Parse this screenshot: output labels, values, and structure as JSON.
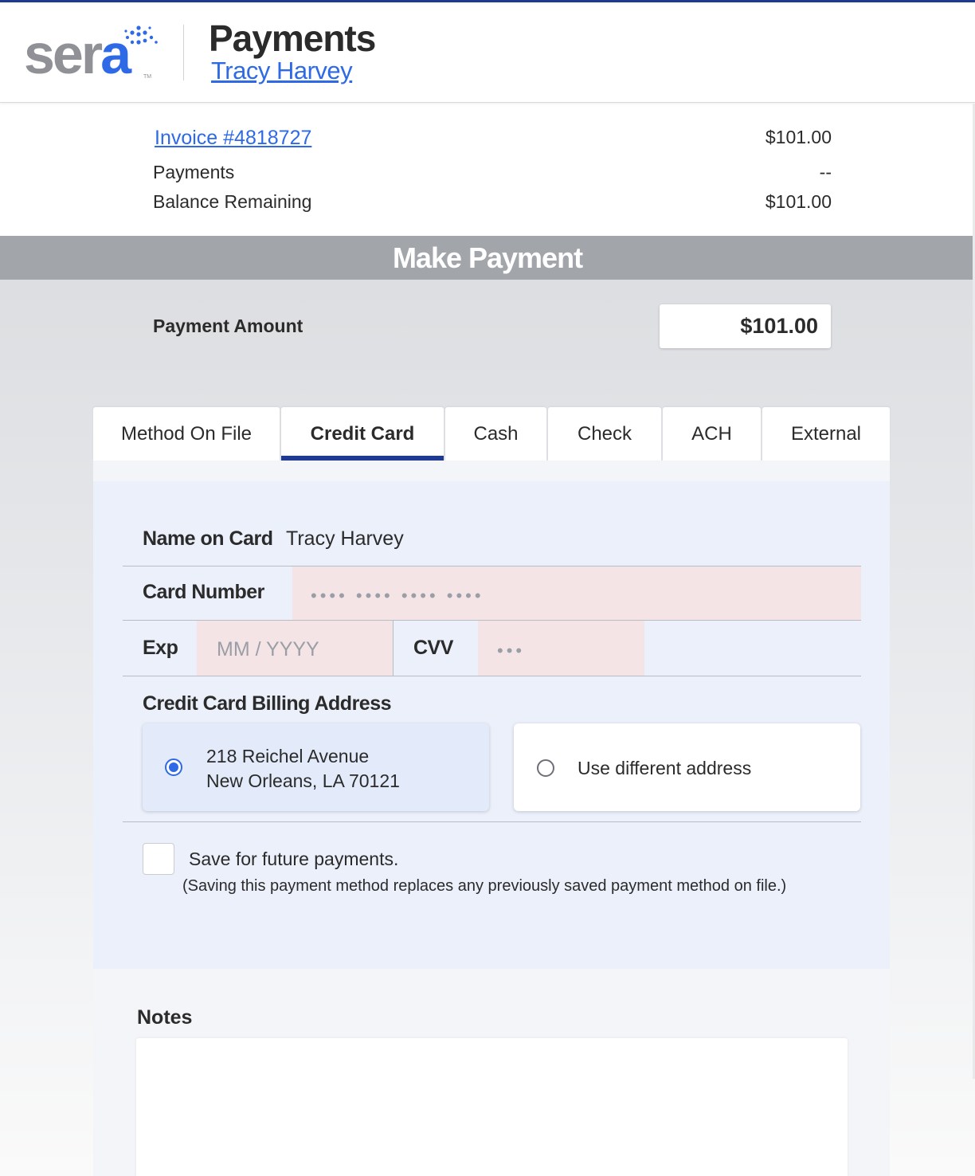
{
  "header": {
    "logo": {
      "text_main": "ser",
      "text_accent": "a",
      "tm": "TM"
    },
    "title": "Payments",
    "patient_name": "Tracy Harvey"
  },
  "summary": {
    "invoice_label": "Invoice #4818727",
    "invoice_amount": "$101.00",
    "payments_label": "Payments",
    "payments_value": "--",
    "balance_label": "Balance Remaining",
    "balance_value": "$101.00"
  },
  "make_payment": {
    "title": "Make Payment",
    "amount_label": "Payment Amount",
    "amount_value": "$101.00"
  },
  "tabs": [
    {
      "label": "Method On File",
      "active": false
    },
    {
      "label": "Credit Card",
      "active": true
    },
    {
      "label": "Cash",
      "active": false
    },
    {
      "label": "Check",
      "active": false
    },
    {
      "label": "ACH",
      "active": false
    },
    {
      "label": "External",
      "active": false
    }
  ],
  "credit_card": {
    "name_label": "Name on Card",
    "name_value": "Tracy Harvey",
    "number_label": "Card Number",
    "number_placeholder": "•••• •••• •••• ••••",
    "exp_label": "Exp",
    "exp_placeholder": "MM / YYYY",
    "cvv_label": "CVV",
    "cvv_placeholder": "•••"
  },
  "billing": {
    "title": "Credit Card Billing Address",
    "saved_address_line1": "218 Reichel Avenue",
    "saved_address_line2": "New Orleans, LA 70121",
    "different_address_label": "Use different address",
    "selected": "saved"
  },
  "save_option": {
    "label": "Save for future payments.",
    "note": "(Saving this payment method replaces any previously saved payment method on file.)",
    "checked": false
  },
  "notes": {
    "label": "Notes",
    "value": ""
  },
  "colors": {
    "accent": "#2e6ae6",
    "navy": "#1f3a93",
    "banner_gray": "#a2a6ab",
    "invalid_field": "#f5e4e5"
  }
}
